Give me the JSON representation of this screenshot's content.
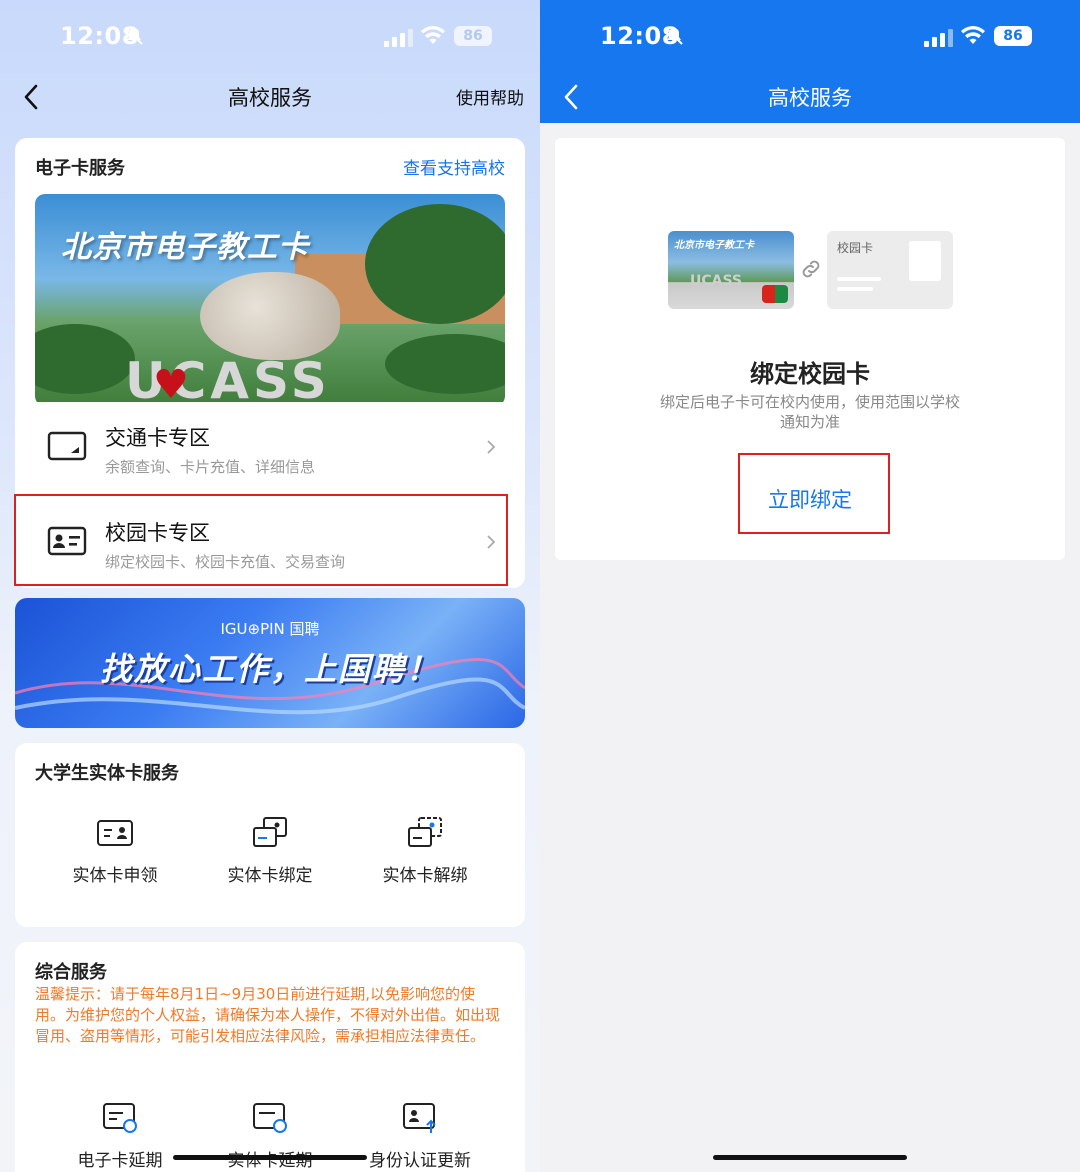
{
  "left": {
    "status": {
      "time": "12:08",
      "battery": "86"
    },
    "nav": {
      "title": "高校服务",
      "help": "使用帮助"
    },
    "ecard": {
      "title": "电子卡服务",
      "link": "查看支持高校",
      "banner_title": "北京市电子教工卡",
      "banner_text": "UCASS",
      "heart": "♥"
    },
    "menu": [
      {
        "title": "交通卡专区",
        "subtitle": "余额查询、卡片充值、详细信息"
      },
      {
        "title": "校园卡专区",
        "subtitle": "绑定校园卡、校园卡充值、交易查询"
      }
    ],
    "ad": {
      "logo": "IGU⊕PIN 国聘",
      "slogan": "找放心工作，上国聘！"
    },
    "physical": {
      "title": "大学生实体卡服务",
      "items": [
        {
          "label": "实体卡申领",
          "icon": "id-card-icon"
        },
        {
          "label": "实体卡绑定",
          "icon": "card-bind-icon"
        },
        {
          "label": "实体卡解绑",
          "icon": "card-unbind-icon"
        }
      ]
    },
    "general": {
      "title": "综合服务",
      "notice": "温馨提示：请于每年8月1日~9月30日前进行延期,以免影响您的使用。为维护您的个人权益，请确保为本人操作，不得对外出借。如出现冒用、盗用等情形，可能引发相应法律风险，需承担相应法律责任。",
      "items": [
        {
          "label": "电子卡延期",
          "icon": "ecard-renew-icon"
        },
        {
          "label": "实体卡延期",
          "icon": "card-renew-icon"
        },
        {
          "label": "身份认证更新",
          "icon": "identity-update-icon"
        }
      ]
    }
  },
  "right": {
    "status": {
      "time": "12:08",
      "battery": "86"
    },
    "nav": {
      "title": "高校服务"
    },
    "card1_title": "北京市电子教工卡",
    "card1_text": "UCASS",
    "card2_title": "校园卡",
    "bind": {
      "title": "绑定校园卡",
      "desc": "绑定后电子卡可在校内使用，使用范围以学校通知为准",
      "button": "立即绑定"
    }
  },
  "colors": {
    "accent": "#1677ee",
    "link": "#1a73e8",
    "warning": "#f07a28",
    "highlight": "#e02020"
  }
}
